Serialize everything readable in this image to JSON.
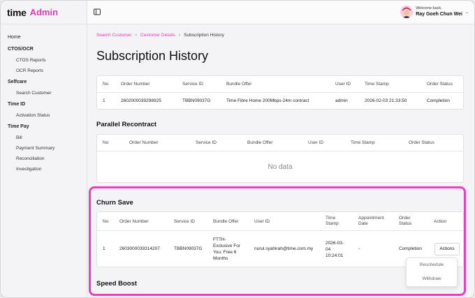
{
  "app": {
    "brand": "time",
    "brand_suffix": "Admin"
  },
  "sidebar": {
    "home": "Home",
    "groups": [
      {
        "title": "CTOS/OCR",
        "items": [
          "CTOS Reports",
          "OCR Reports"
        ]
      },
      {
        "title": "Selfcare",
        "items": [
          "Search Customer"
        ]
      },
      {
        "title": "Time ID",
        "items": [
          "Activation Status"
        ]
      },
      {
        "title": "Time Pay",
        "items": [
          "Bill",
          "Payment Summary",
          "Reconciliation",
          "Investigation"
        ]
      }
    ]
  },
  "topbar": {
    "welcome": "Welcome back,",
    "user_name": "Ray Goeh Chun Wei"
  },
  "breadcrumb": {
    "items": [
      "Search Customer",
      "Customer Details",
      "Subscription History"
    ]
  },
  "page_title": "Subscription History",
  "subscription_table": {
    "headers": [
      "No",
      "Order Number",
      "Service ID",
      "Bundle Offer",
      "User ID",
      "Time Stamp",
      "Order Status"
    ],
    "rows": [
      [
        "1",
        "2602000039298925",
        "TBBN09037G",
        "Time Fibre Home 200Mbps-24m contract",
        "admin",
        "2026-02-03 21:33:50",
        "Completion"
      ]
    ]
  },
  "parallel": {
    "title": "Parallel Recontract",
    "headers": [
      "No",
      "Order Number",
      "Service ID",
      "Bundle Offer",
      "User ID",
      "Time Stamp",
      "Order Status"
    ],
    "empty": "No data"
  },
  "churn": {
    "title": "Churn Save",
    "headers": [
      "No",
      "Order Number",
      "Service ID",
      "Bundle Offer",
      "User ID",
      "Time\nStamp",
      "Appointment\nDate",
      "Order\nStatus",
      "Action"
    ],
    "row": [
      "1",
      "2603000039314207",
      "TBBN09037G",
      "FTTH-\nExclusive For\nYou: Free 6\nMonths",
      "nurul.syahirah@time.com.my",
      "2026-03-\n04\n10:24:01",
      "-",
      "Completion"
    ],
    "action_label": "Actions",
    "menu": [
      "Reschedule",
      "Withdraw"
    ]
  },
  "speed_boost": {
    "title": "Speed Boost"
  },
  "colors": {
    "accent": "#e43bb7",
    "highlight": "#ea3fc3"
  }
}
